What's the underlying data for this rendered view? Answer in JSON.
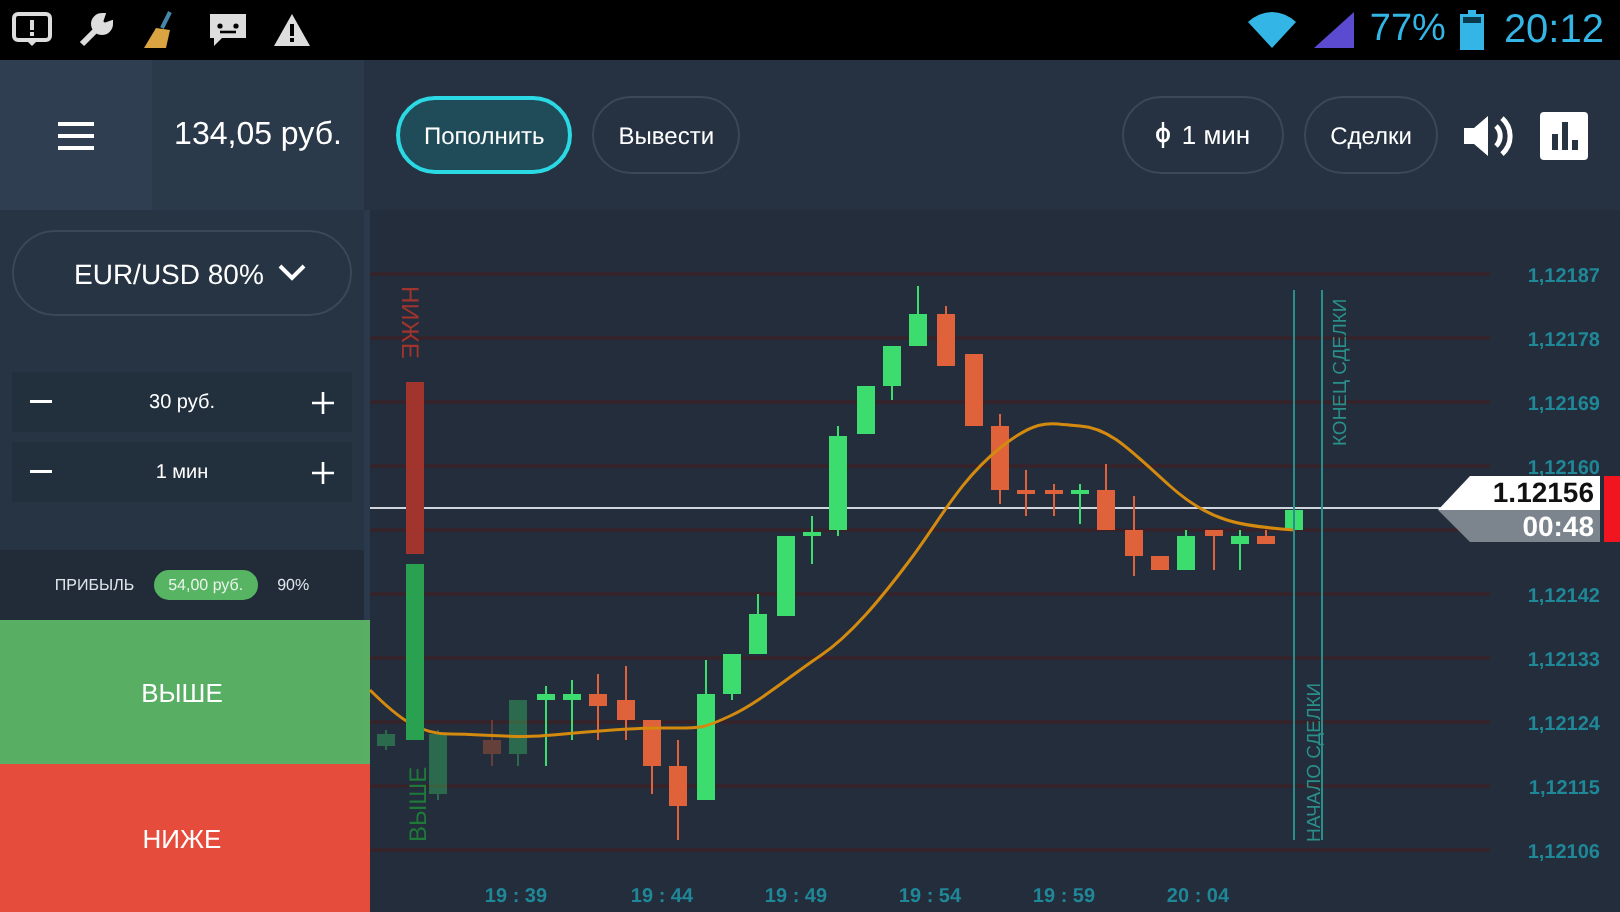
{
  "status_bar": {
    "battery": "77%",
    "time": "20:12"
  },
  "header": {
    "balance": "134,05 руб."
  },
  "toolbar": {
    "buttons": [
      {
        "label": "Пополнить",
        "kind": "primary"
      },
      {
        "label": "Вывести",
        "kind": "outline"
      }
    ],
    "timeframe": "1 мин",
    "deals": "Сделки"
  },
  "asset": {
    "label": "EUR/USD 80%"
  },
  "steppers": [
    {
      "value": "30 руб."
    },
    {
      "value": "1 мин"
    }
  ],
  "profit": {
    "label": "ПРИБЫЛЬ",
    "amount": "54,00 руб.",
    "percent": "90%"
  },
  "trade_buttons": [
    {
      "label": "ВЫШЕ",
      "kind": "up"
    },
    {
      "label": "НИЖЕ",
      "kind": "down"
    }
  ],
  "chart": {
    "y_labels": [
      "1,12187",
      "1,12178",
      "1,12169",
      "1,12160",
      "1,12142",
      "1,12133",
      "1,12124",
      "1,12115",
      "1,12106"
    ],
    "x_labels": [
      "19 : 39",
      "19 : 44",
      "19 : 49",
      "19 : 54",
      "19 : 59",
      "20 : 04"
    ],
    "side_labels": [
      {
        "label": "НИЖЕ",
        "kind": "down"
      },
      {
        "label": "ВЫШЕ",
        "kind": "up"
      }
    ],
    "price": "1.12156",
    "countdown": "00:48",
    "trade_start": "НАЧАЛО СДЕЛКИ",
    "trade_end": "КОНЕЦ СДЕЛКИ"
  }
}
